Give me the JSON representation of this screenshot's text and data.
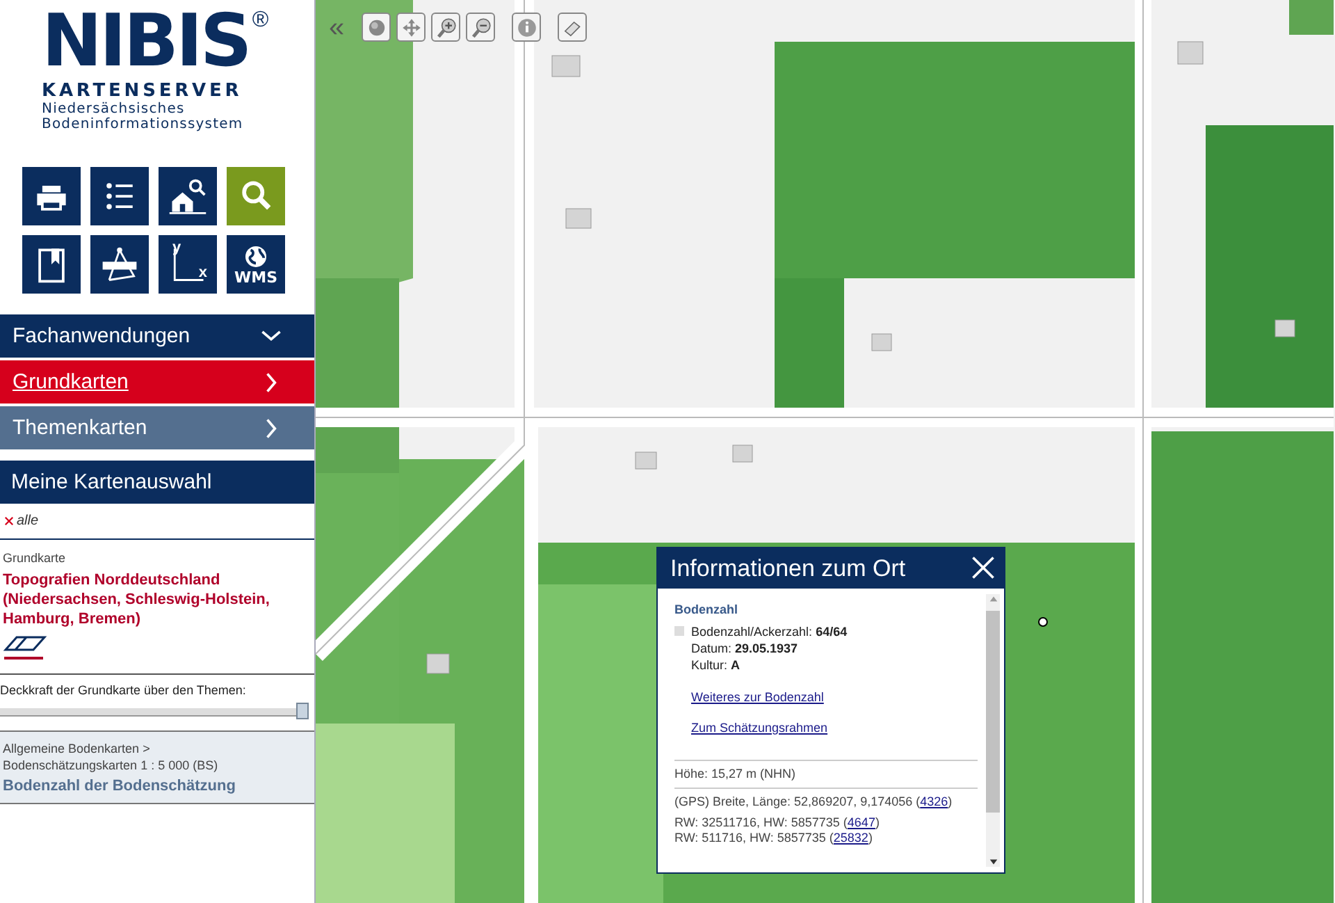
{
  "logo": {
    "title": "NIBIS",
    "mark": "®",
    "subtitle": "KARTENSERVER",
    "tagline": [
      "Niedersächsisches",
      "Bodeninformationssystem"
    ]
  },
  "tools": [
    {
      "kind": "print",
      "selected": false
    },
    {
      "kind": "list",
      "selected": false
    },
    {
      "kind": "home-search",
      "selected": false
    },
    {
      "kind": "search",
      "selected": true
    },
    {
      "kind": "bookmark",
      "selected": false
    },
    {
      "kind": "measure",
      "selected": false
    },
    {
      "kind": "coordinates",
      "selected": false,
      "labels": [
        "y",
        "x"
      ]
    },
    {
      "kind": "wms",
      "selected": false,
      "labels": [
        "WMS"
      ]
    }
  ],
  "menu": [
    {
      "label": "Fachanwendungen",
      "kind": "dropdown",
      "selected": false
    },
    {
      "label": "Grundkarten",
      "kind": "category",
      "selected": true
    },
    {
      "label": "Themenkarten",
      "kind": "category",
      "selected": false
    }
  ],
  "selection": {
    "title": "Meine Kartenauswahl",
    "remove_all": "alle",
    "basemap_label": "Grundkarte",
    "basemap": "Topografien Norddeutschland (Niedersachsen, Schleswig-Holstein, Hamburg, Bremen)",
    "opacity_label": "Deckkraft der Grundkarte über den Themen:",
    "opacity": {
      "level": 1
    },
    "theme_path": [
      "Allgemeine Bodenkarten",
      ">",
      "Bodenschätzungskarten 1 : 5 000 (BS)"
    ],
    "theme": "Bodenzahl der Bodenschätzung"
  },
  "map_toolbar": {
    "collapse": "«",
    "tools": [
      {
        "kind": "globe"
      },
      {
        "kind": "pan"
      },
      {
        "kind": "zoom-in"
      },
      {
        "kind": "zoom-out"
      },
      {
        "kind": "info"
      },
      {
        "kind": "eraser"
      }
    ]
  },
  "popup": {
    "title": "Informationen zum Ort",
    "section": "Bodenzahl",
    "fields": [
      {
        "label": "Bodenzahl/Ackerzahl:",
        "value": "64/64"
      },
      {
        "label": "Datum:",
        "value": "29.05.1937"
      },
      {
        "label": "Kultur:",
        "value": "A"
      }
    ],
    "links": [
      "Weiteres zur Bodenzahl",
      "Zum Schätzungsrahmen"
    ],
    "height": "Höhe: 15,27 m (NHN)",
    "coords": [
      {
        "prefix": "(GPS) Breite, Länge: 52,869207, 9,174056 (",
        "link": "4326",
        "suffix": ")"
      },
      {
        "prefix": "RW: 32511716, HW: 5857735 (",
        "link": "4647",
        "suffix": ")"
      },
      {
        "prefix": "RW: 511716, HW: 5857735 (",
        "link": "25832",
        "suffix": ")"
      }
    ]
  }
}
